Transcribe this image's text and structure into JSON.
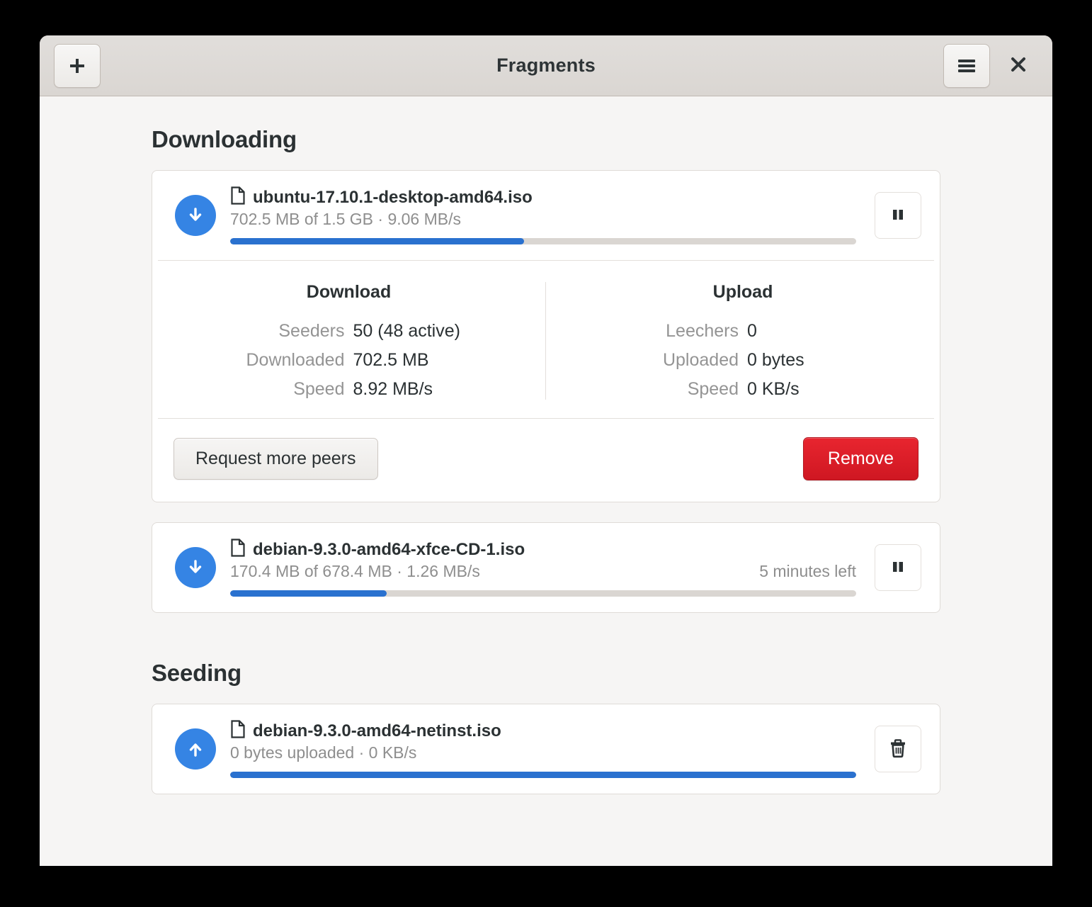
{
  "window": {
    "title": "Fragments",
    "accent_color": "#3584e4",
    "progress_color": "#2a71cf",
    "destructive_color": "#e01b24",
    "background_color": "#f6f5f4",
    "headerbar_color": "#dad6d2"
  },
  "headerbar": {
    "add_button_icon": "plus-icon",
    "add_button_label": "+",
    "menu_button_icon": "hamburger-menu-icon",
    "close_button_icon": "close-icon"
  },
  "sections": [
    {
      "heading": "Downloading",
      "torrents": [
        {
          "file_icon": "file-document-icon",
          "status_icon": "download-arrow-icon",
          "name": "ubuntu-17.10.1-desktop-amd64.iso",
          "subtitle": "702.5 MB of 1.5 GB · 9.06 MB/s",
          "eta": "",
          "progress_percent": 47,
          "action_icon": "pause-icon",
          "expanded": true,
          "details": {
            "columns": [
              {
                "heading": "Download",
                "rows": [
                  {
                    "key": "Seeders",
                    "value": "50 (48 active)"
                  },
                  {
                    "key": "Downloaded",
                    "value": "702.5 MB"
                  },
                  {
                    "key": "Speed",
                    "value": "8.92 MB/s"
                  }
                ]
              },
              {
                "heading": "Upload",
                "rows": [
                  {
                    "key": "Leechers",
                    "value": "0"
                  },
                  {
                    "key": "Uploaded",
                    "value": "0 bytes"
                  },
                  {
                    "key": "Speed",
                    "value": "0 KB/s"
                  }
                ]
              }
            ],
            "secondary_button": "Request more peers",
            "destructive_button": "Remove"
          }
        },
        {
          "file_icon": "file-document-icon",
          "status_icon": "download-arrow-icon",
          "name": "debian-9.3.0-amd64-xfce-CD-1.iso",
          "subtitle": "170.4 MB of 678.4 MB · 1.26 MB/s",
          "eta": "5 minutes left",
          "progress_percent": 25,
          "action_icon": "pause-icon",
          "expanded": false
        }
      ]
    },
    {
      "heading": "Seeding",
      "torrents": [
        {
          "file_icon": "file-document-icon",
          "status_icon": "upload-arrow-icon",
          "name": "debian-9.3.0-amd64-netinst.iso",
          "subtitle": "0 bytes uploaded · 0 KB/s",
          "eta": "",
          "progress_percent": 100,
          "action_icon": "trash-icon",
          "expanded": false
        }
      ]
    }
  ]
}
